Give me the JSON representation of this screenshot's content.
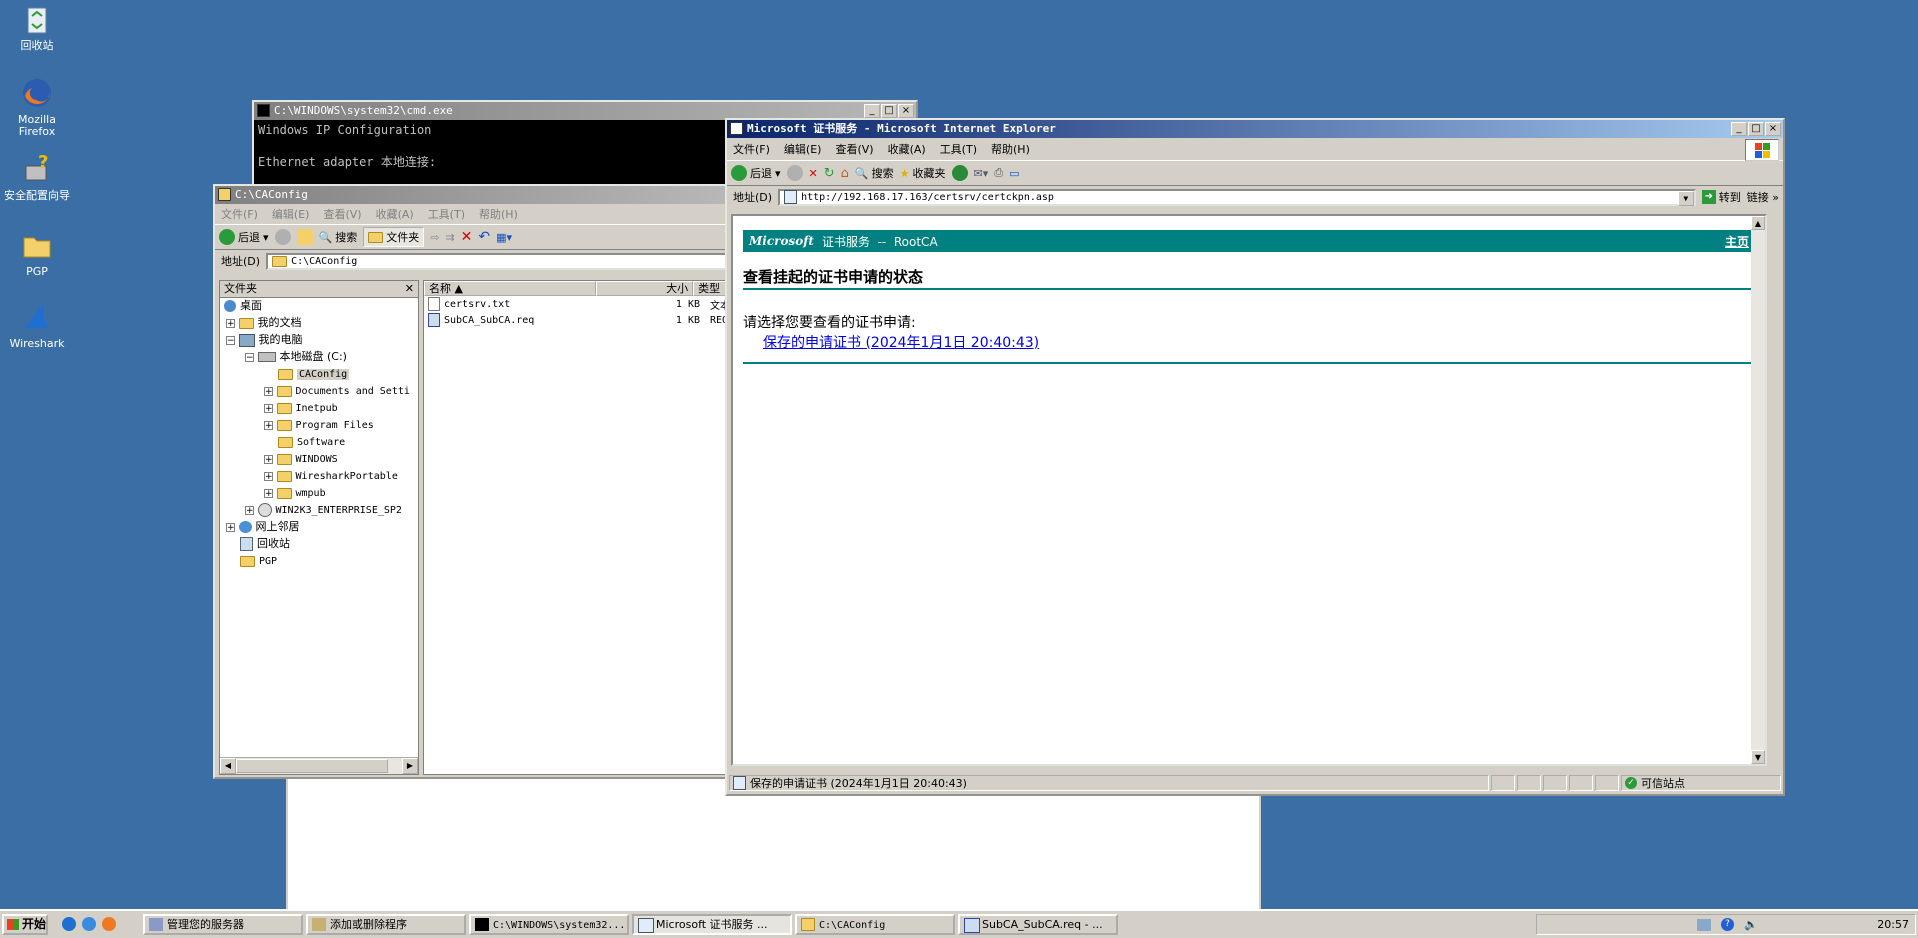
{
  "desktop": {
    "icons": [
      {
        "label": "回收站"
      },
      {
        "label": "Mozilla Firefox"
      },
      {
        "label": "安全配置向导"
      },
      {
        "label": "PGP"
      },
      {
        "label": "Wireshark"
      }
    ]
  },
  "cmd": {
    "title": "C:\\WINDOWS\\system32\\cmd.exe",
    "line1": "Windows IP Configuration",
    "line2": "Ethernet adapter 本地连接:"
  },
  "explorer": {
    "title": "C:\\CAConfig",
    "menu": [
      "文件(F)",
      "编辑(E)",
      "查看(V)",
      "收藏(A)",
      "工具(T)",
      "帮助(H)"
    ],
    "toolbar": {
      "back": "后退",
      "search": "搜索",
      "folders": "文件夹"
    },
    "address_label": "地址(D)",
    "address_value": "C:\\CAConfig",
    "pane_title": "文件夹",
    "tree": [
      {
        "label": "桌面"
      },
      {
        "label": "我的文档"
      },
      {
        "label": "我的电脑"
      },
      {
        "label": "本地磁盘 (C:)"
      },
      {
        "label": "CAConfig"
      },
      {
        "label": "Documents and Setti"
      },
      {
        "label": "Inetpub"
      },
      {
        "label": "Program Files"
      },
      {
        "label": "Software"
      },
      {
        "label": "WINDOWS"
      },
      {
        "label": "WiresharkPortable"
      },
      {
        "label": "wmpub"
      },
      {
        "label": "WIN2K3_ENTERPRISE_SP2"
      },
      {
        "label": "网上邻居"
      },
      {
        "label": "回收站"
      },
      {
        "label": "PGP"
      }
    ],
    "columns": {
      "name": "名称",
      "size": "大小",
      "type": "类型"
    },
    "files": [
      {
        "name": "certsrv.txt",
        "size": "1 KB",
        "type": "文本"
      },
      {
        "name": "SubCA_SubCA.req",
        "size": "1 KB",
        "type": "REQ"
      }
    ]
  },
  "ie": {
    "title": "Microsoft 证书服务 - Microsoft Internet Explorer",
    "menu": [
      "文件(F)",
      "编辑(E)",
      "查看(V)",
      "收藏(A)",
      "工具(T)",
      "帮助(H)"
    ],
    "toolbar": {
      "back": "后退",
      "search": "搜索",
      "favorites": "收藏夹"
    },
    "address_label": "地址(D)",
    "address_value": "http://192.168.17.163/certsrv/certckpn.asp",
    "go_label": "转到",
    "links_label": "链接",
    "page": {
      "banner_brand": "Microsoft",
      "banner_text": "证书服务  --  RootCA",
      "home_link": "主页",
      "heading": "查看挂起的证书申请的状态",
      "prompt": "请选择您要查看的证书申请:",
      "request_link": "保存的申请证书 (2024年1月1日 20:40:43)"
    },
    "status_text": "保存的申请证书 (2024年1月1日 20:40:43)",
    "zone": "可信站点"
  },
  "taskbar": {
    "start": "开始",
    "tasks": [
      {
        "label": "管理您的服务器"
      },
      {
        "label": "添加或删除程序"
      },
      {
        "label": "C:\\WINDOWS\\system32..."
      },
      {
        "label": "Microsoft 证书服务 ..."
      },
      {
        "label": "C:\\CAConfig"
      },
      {
        "label": "SubCA_SubCA.req - ..."
      }
    ],
    "clock": "20:57"
  }
}
